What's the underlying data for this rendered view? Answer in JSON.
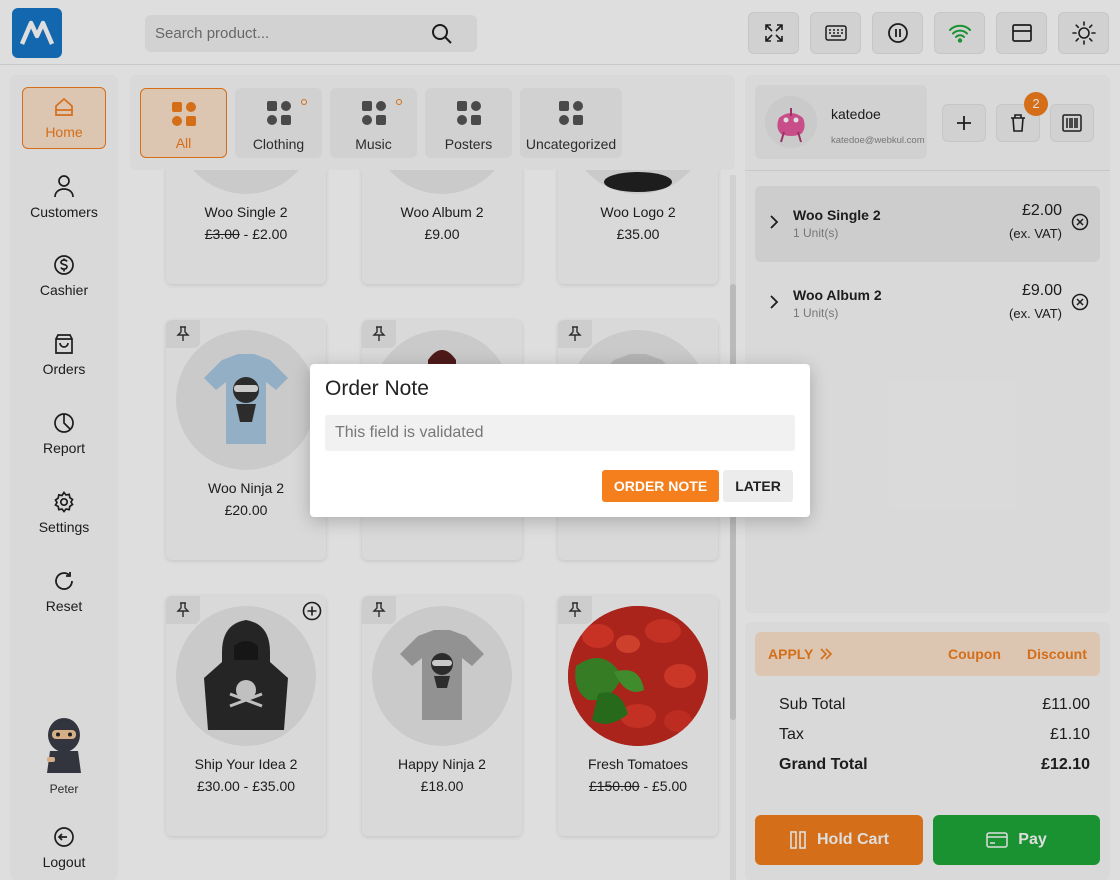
{
  "search": {
    "placeholder": "Search product..."
  },
  "nav": {
    "items": [
      {
        "label": "Home",
        "icon": "home-icon"
      },
      {
        "label": "Customers",
        "icon": "user-icon"
      },
      {
        "label": "Cashier",
        "icon": "dollar-icon"
      },
      {
        "label": "Orders",
        "icon": "bag-icon"
      },
      {
        "label": "Report",
        "icon": "pie-chart-icon"
      },
      {
        "label": "Settings",
        "icon": "gear-icon"
      },
      {
        "label": "Reset",
        "icon": "reset-icon"
      },
      {
        "label": "Logout",
        "icon": "logout-icon"
      }
    ],
    "user_name": "Peter"
  },
  "categories": [
    {
      "label": "All"
    },
    {
      "label": "Clothing"
    },
    {
      "label": "Music"
    },
    {
      "label": "Posters"
    },
    {
      "label": "Uncategorized"
    }
  ],
  "products": [
    {
      "name": "Woo Single 2",
      "price_old": "£3.00",
      "price": " - £2.00"
    },
    {
      "name": "Woo Album 2",
      "price": "£9.00"
    },
    {
      "name": "Woo Logo 2",
      "price": "£35.00"
    },
    {
      "name": "Woo Ninja 2",
      "price": "£20.00"
    },
    {
      "name": "Ship Your Idea 2",
      "price": "£30.00 - £35.00"
    },
    {
      "name": "Happy Ninja 2",
      "price": "£18.00"
    },
    {
      "name": "Fresh Tomatoes",
      "price_old": "£150.00",
      "price": " - £5.00"
    }
  ],
  "customer": {
    "name": "katedoe",
    "email": "katedoe@webkul.com",
    "cart_count": "2"
  },
  "cart": [
    {
      "name": "Woo Single 2",
      "units": "1 Unit(s)",
      "price": "£2.00",
      "vat": "(ex. VAT)"
    },
    {
      "name": "Woo Album 2",
      "units": "1 Unit(s)",
      "price": "£9.00",
      "vat": "(ex. VAT)"
    }
  ],
  "apply_bar": {
    "apply": "APPLY",
    "coupon": "Coupon",
    "discount": "Discount"
  },
  "totals": {
    "subtotal_label": "Sub Total",
    "subtotal": "£11.00",
    "tax_label": "Tax",
    "tax": "£1.10",
    "grand_label": "Grand Total",
    "grand": "£12.10"
  },
  "actions": {
    "hold": "Hold Cart",
    "pay": "Pay"
  },
  "modal": {
    "title": "Order Note",
    "placeholder": "This field is validated",
    "primary": "ORDER NOTE",
    "secondary": "LATER"
  },
  "colors": {
    "accent": "#f47f1c",
    "pay": "#1fa83a",
    "logo": "#1677c9"
  }
}
